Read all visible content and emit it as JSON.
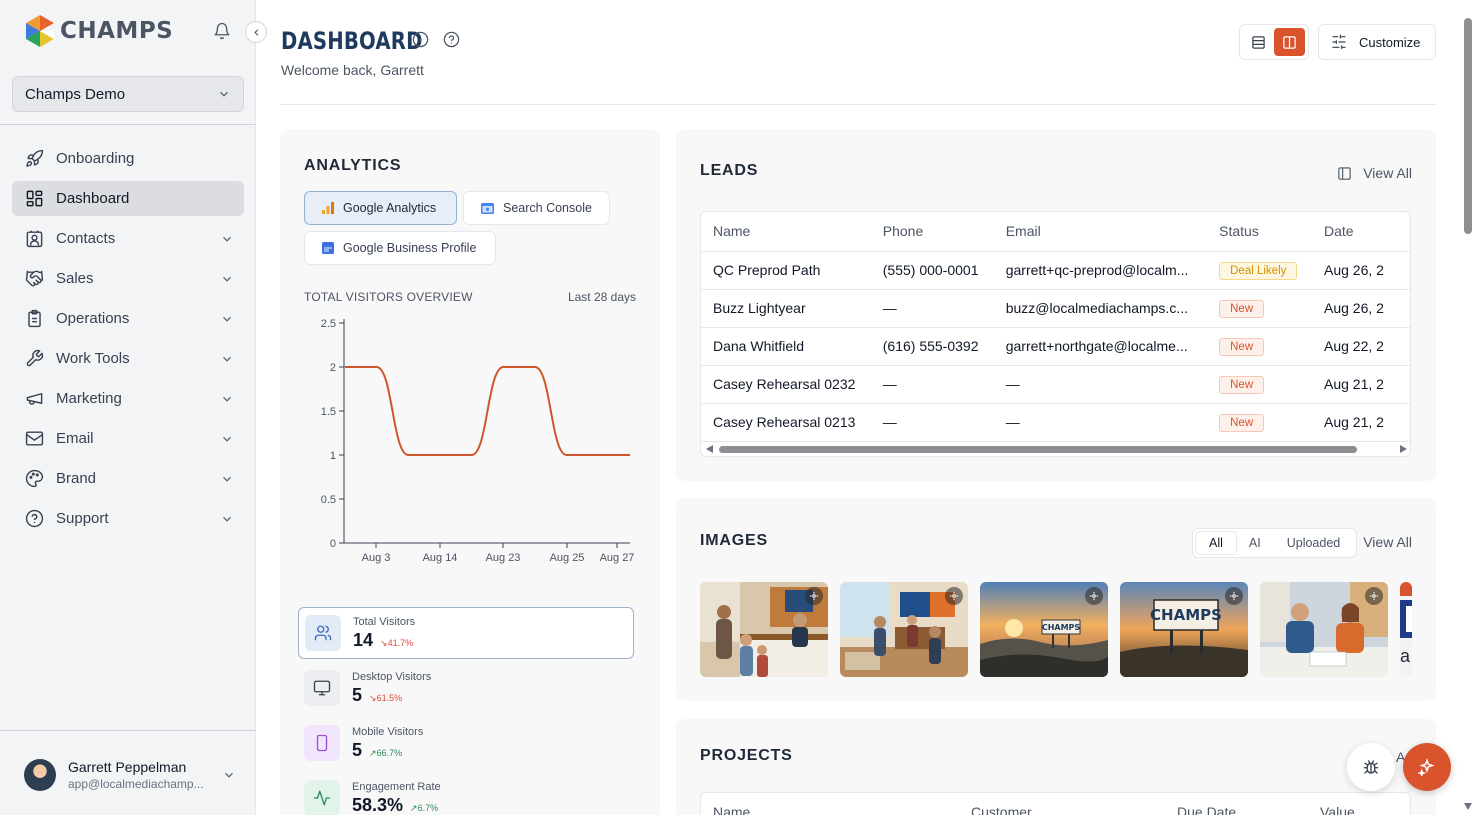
{
  "brand": {
    "name": "CHAMPS"
  },
  "sidebar": {
    "account": "Champs Demo",
    "items": [
      {
        "label": "Onboarding",
        "icon": "rocket-icon",
        "expandable": false,
        "active": false
      },
      {
        "label": "Dashboard",
        "icon": "grid-icon",
        "expandable": false,
        "active": true
      },
      {
        "label": "Contacts",
        "icon": "contact-icon",
        "expandable": true,
        "active": false
      },
      {
        "label": "Sales",
        "icon": "handshake-icon",
        "expandable": true,
        "active": false
      },
      {
        "label": "Operations",
        "icon": "clipboard-icon",
        "expandable": true,
        "active": false
      },
      {
        "label": "Work Tools",
        "icon": "wrench-icon",
        "expandable": true,
        "active": false
      },
      {
        "label": "Marketing",
        "icon": "megaphone-icon",
        "expandable": true,
        "active": false
      },
      {
        "label": "Email",
        "icon": "mail-icon",
        "expandable": true,
        "active": false
      },
      {
        "label": "Brand",
        "icon": "palette-icon",
        "expandable": true,
        "active": false
      },
      {
        "label": "Support",
        "icon": "help-circle-icon",
        "expandable": true,
        "active": false
      }
    ],
    "user": {
      "name": "Garrett Peppelman",
      "email": "app@localmediachamp..."
    }
  },
  "header": {
    "title": "DASHBOARD",
    "welcome": "Welcome back, Garrett",
    "customize_label": "Customize"
  },
  "analytics": {
    "title": "ANALYTICS",
    "tabs": [
      {
        "label": "Google Analytics",
        "active": true
      },
      {
        "label": "Search Console",
        "active": false
      },
      {
        "label": "Google Business Profile",
        "active": false
      }
    ],
    "overview_label": "TOTAL VISITORS OVERVIEW",
    "range_label": "Last 28 days",
    "metrics": [
      {
        "label": "Total Visitors",
        "value": "14",
        "delta": "41.7%",
        "trend": "down"
      },
      {
        "label": "Desktop Visitors",
        "value": "5",
        "delta": "61.5%",
        "trend": "down"
      },
      {
        "label": "Mobile Visitors",
        "value": "5",
        "delta": "66.7%",
        "trend": "up"
      },
      {
        "label": "Engagement Rate",
        "value": "58.3%",
        "delta": "6.7%",
        "trend": "up"
      }
    ]
  },
  "chart_data": {
    "type": "line",
    "title": "TOTAL VISITORS OVERVIEW",
    "ylim": [
      0,
      2.5
    ],
    "yticks": [
      "0",
      "0.5",
      "1",
      "1.5",
      "2",
      "2.5"
    ],
    "xtick_labels": [
      "Aug 3",
      "Aug 14",
      "Aug 23",
      "Aug 25",
      "Aug 27"
    ],
    "series": [
      {
        "values": [
          2,
          2,
          1,
          1,
          1,
          2,
          2,
          1,
          1,
          1
        ],
        "color": "#d0542b"
      }
    ],
    "grid": false
  },
  "leads": {
    "title": "LEADS",
    "view_all": "View All",
    "columns": [
      "Name",
      "Phone",
      "Email",
      "Status",
      "Date"
    ],
    "rows": [
      {
        "name": "QC Preprod Path",
        "phone": "(555) 000-0001",
        "email": "garrett+qc-preprod@localm...",
        "status": "Deal Likely",
        "date": "Aug 26, 2"
      },
      {
        "name": "Buzz Lightyear",
        "phone": "—",
        "email": "buzz@localmediachamps.c...",
        "status": "New",
        "date": "Aug 26, 2"
      },
      {
        "name": "Dana Whitfield",
        "phone": "(616) 555-0392",
        "email": "garrett+northgate@localme...",
        "status": "New",
        "date": "Aug 22, 2"
      },
      {
        "name": "Casey Rehearsal 0232",
        "phone": "—",
        "email": "—",
        "status": "New",
        "date": "Aug 21, 2"
      },
      {
        "name": "Casey Rehearsal 0213",
        "phone": "—",
        "email": "—",
        "status": "New",
        "date": "Aug 21, 2"
      }
    ]
  },
  "images": {
    "title": "IMAGES",
    "filters": [
      "All",
      "AI",
      "Uploaded"
    ],
    "active_filter": "All",
    "view_all": "View All",
    "sign_text": "CHAMPS",
    "partial_text": "a"
  },
  "projects": {
    "title": "PROJECTS",
    "columns": [
      "Name",
      "Customer",
      "Due Date",
      "Value"
    ],
    "peek_text": "A"
  },
  "colors": {
    "accent": "#d9532c",
    "title": "#1e3a5f"
  }
}
